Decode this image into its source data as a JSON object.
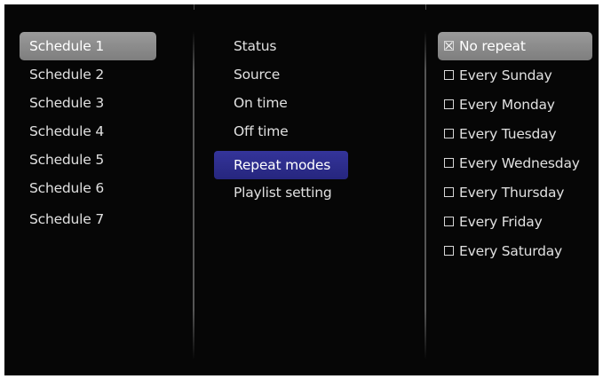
{
  "schedules": {
    "items": [
      "Schedule 1",
      "Schedule 2",
      "Schedule 3",
      "Schedule 4",
      "Schedule 5",
      "Schedule 6",
      "Schedule 7"
    ],
    "selected_index": 0
  },
  "settings": {
    "items": [
      "Status",
      "Source",
      "On time",
      "Off time",
      "Repeat modes",
      "Playlist setting"
    ],
    "selected_index": 4
  },
  "repeat": {
    "items": [
      {
        "label": "No repeat",
        "checked": true
      },
      {
        "label": "Every Sunday",
        "checked": false
      },
      {
        "label": "Every Monday",
        "checked": false
      },
      {
        "label": "Every Tuesday",
        "checked": false
      },
      {
        "label": "Every Wednesday",
        "checked": false
      },
      {
        "label": "Every Thursday",
        "checked": false
      },
      {
        "label": "Every Friday",
        "checked": false
      },
      {
        "label": "Every Saturday",
        "checked": false
      }
    ],
    "selected_index": 0
  },
  "colors": {
    "background": "#060606",
    "highlight_grey": "#8a8a8a",
    "highlight_blue": "#2c2c8c",
    "text": "#e0e0e0"
  }
}
